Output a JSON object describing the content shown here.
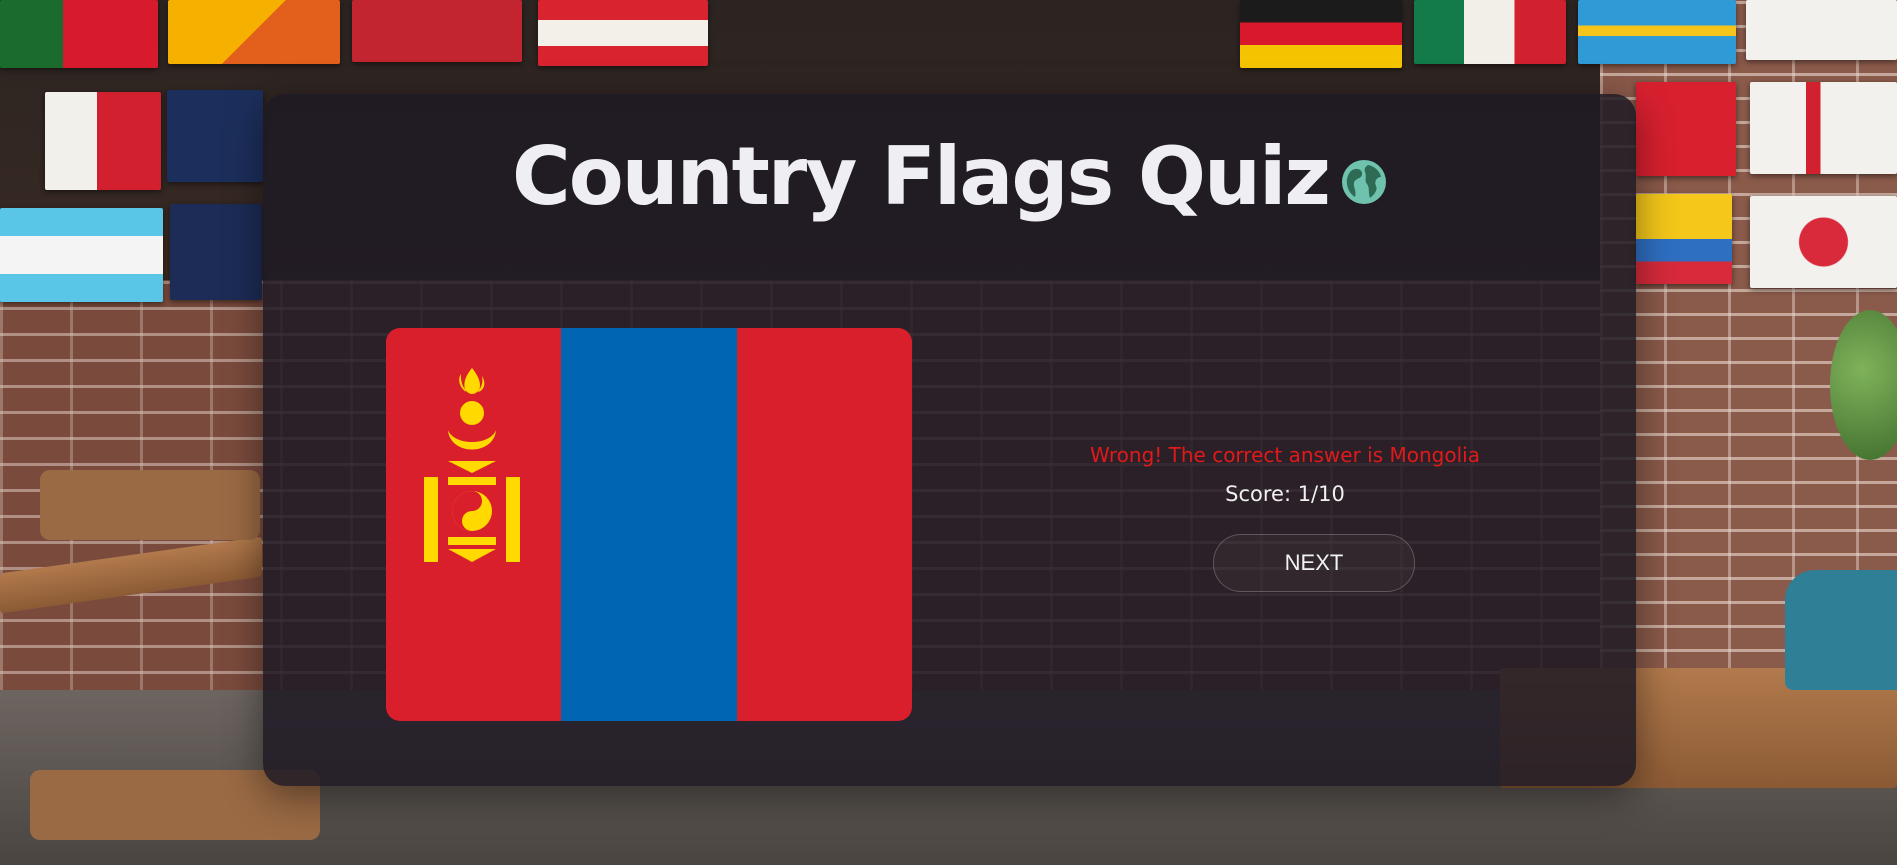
{
  "quiz": {
    "title": "Country Flags Quiz",
    "title_icon": "globe-icon",
    "feedback": "Wrong! The correct answer is Mongolia",
    "score": "Score: 1/10",
    "next_label": "NEXT"
  },
  "flag": {
    "country": "Mongolia",
    "stripe_colors": [
      "#DA1F2C",
      "#0066B3",
      "#DA1F2C"
    ],
    "soyombo_color": "#FFD900"
  },
  "colors": {
    "card_background": "#1e1a24",
    "title_text": "#eeeef3",
    "feedback_text": "#e01a1a",
    "globe_land": "#2d6b55",
    "globe_ocean": "#6fc2ad"
  }
}
